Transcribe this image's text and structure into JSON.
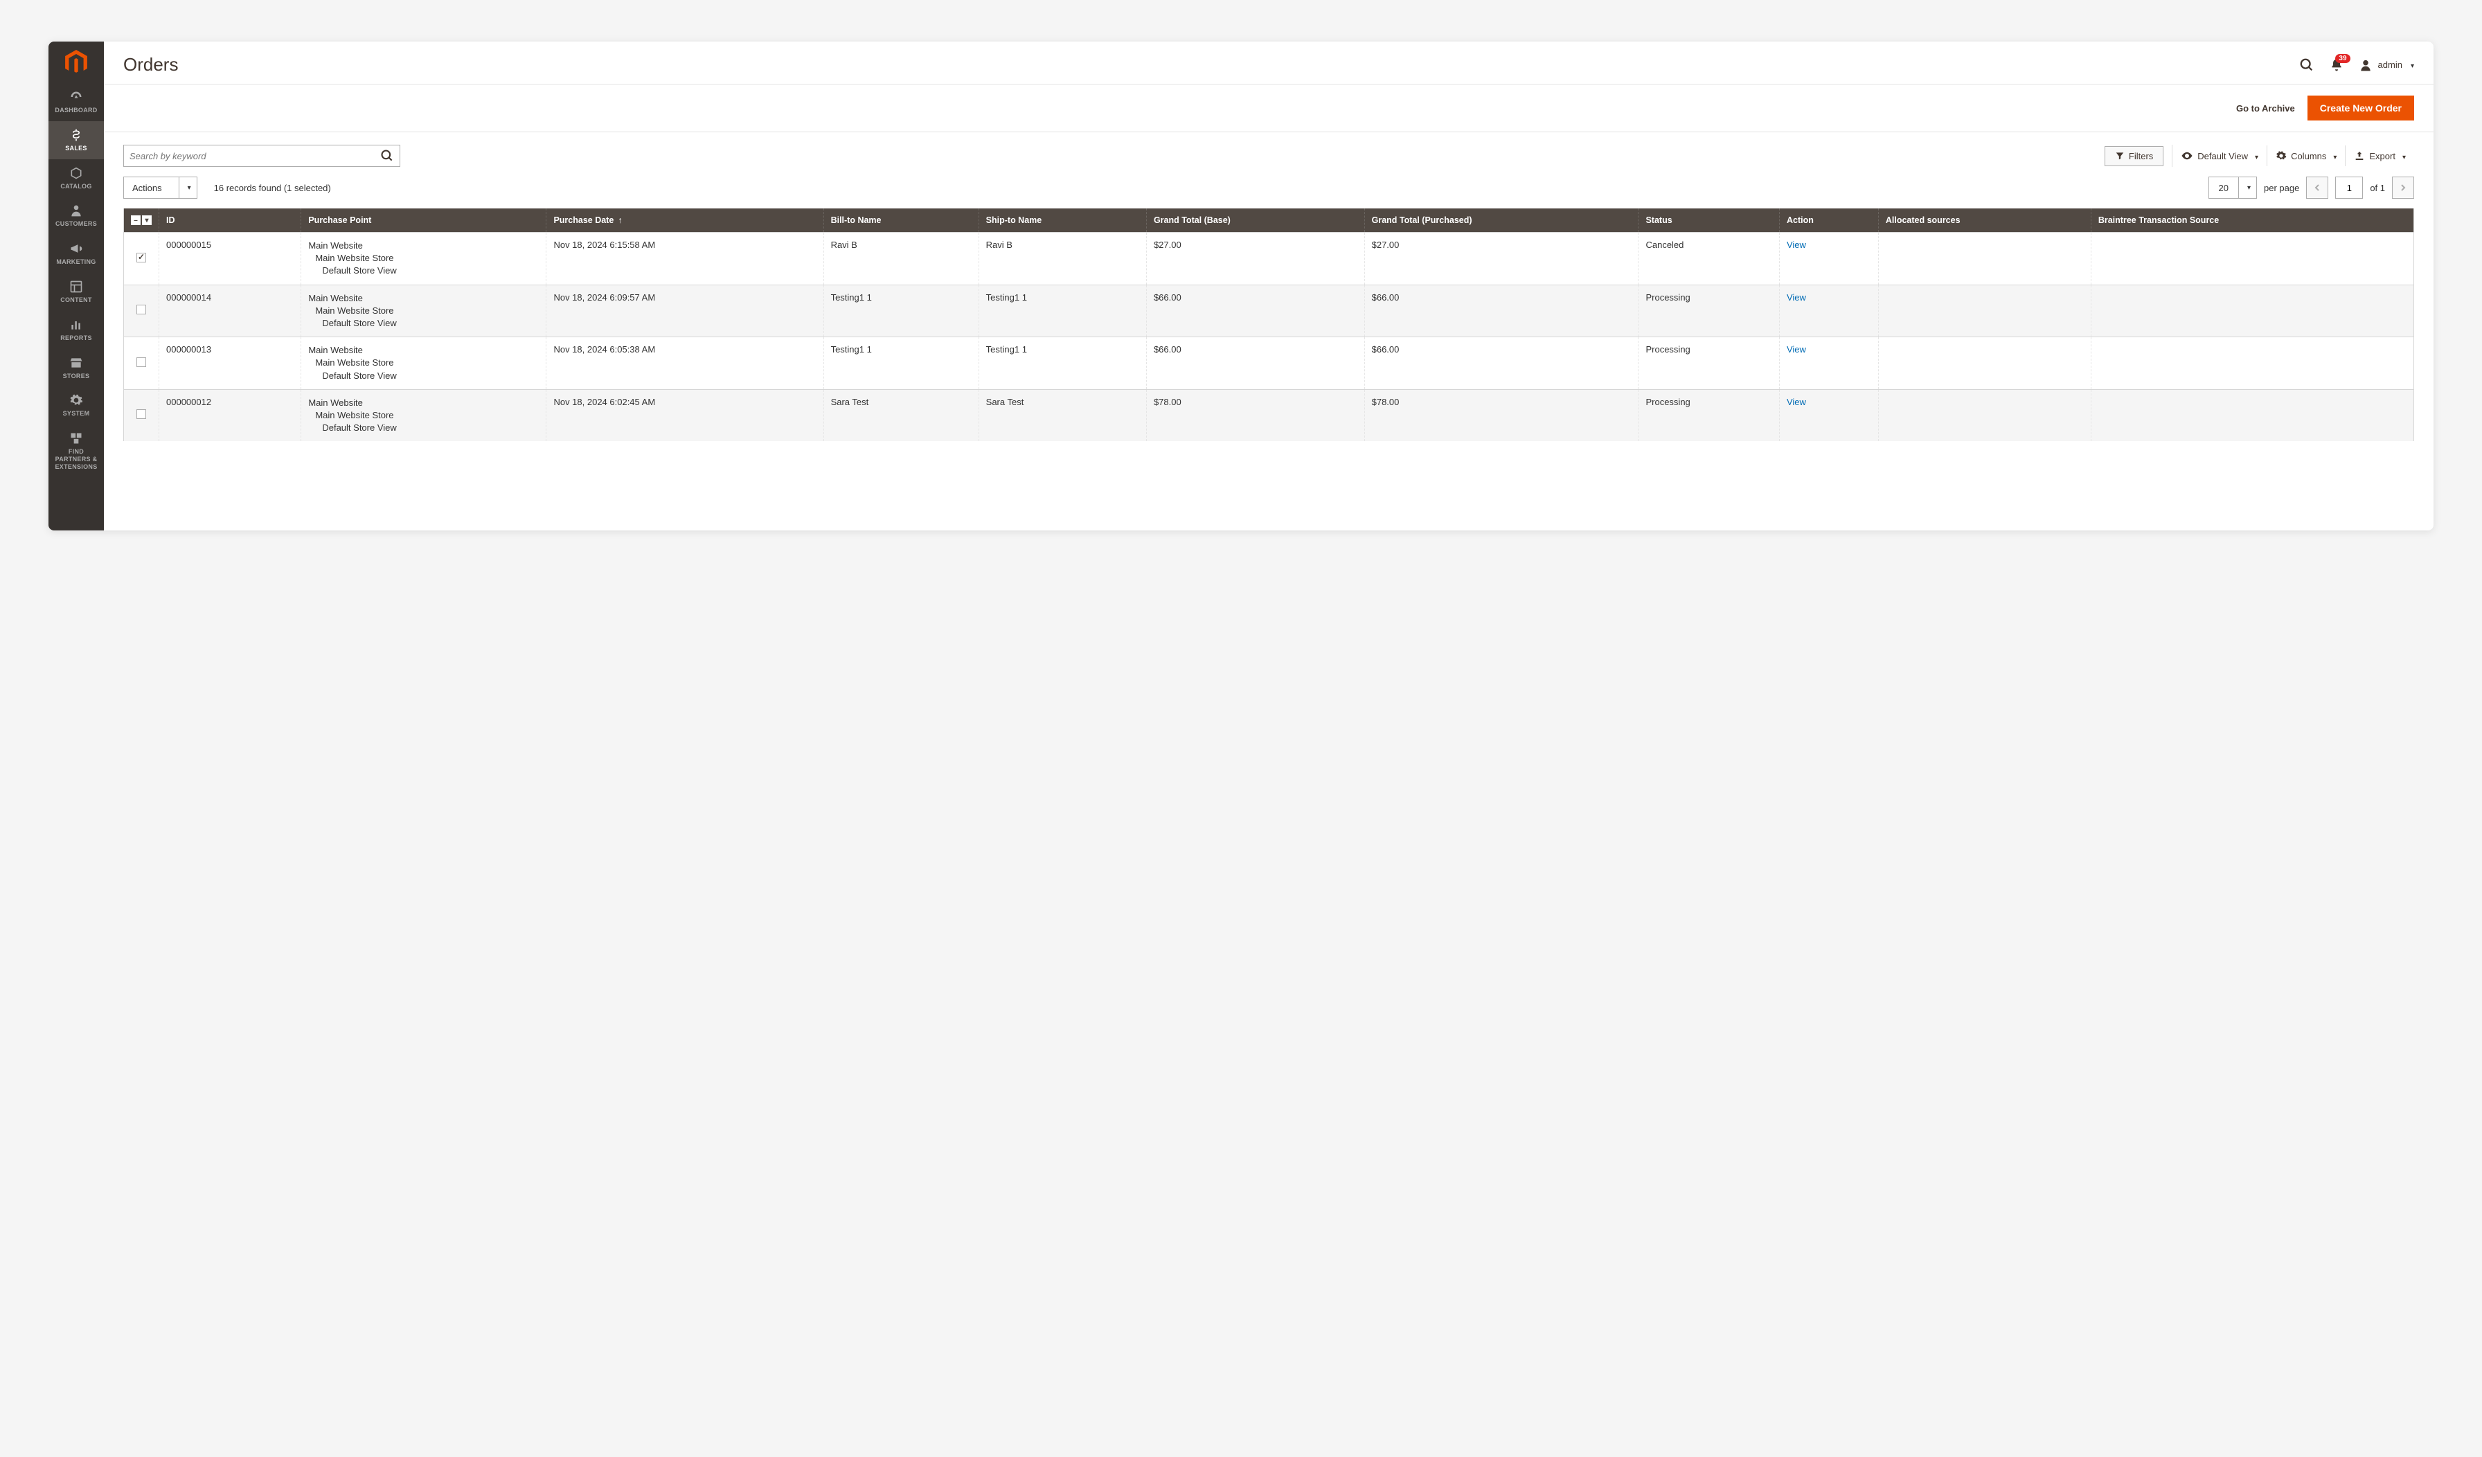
{
  "sidebar": {
    "items": [
      {
        "label": "DASHBOARD",
        "icon": "gauge"
      },
      {
        "label": "SALES",
        "icon": "dollar",
        "active": true
      },
      {
        "label": "CATALOG",
        "icon": "box"
      },
      {
        "label": "CUSTOMERS",
        "icon": "person"
      },
      {
        "label": "MARKETING",
        "icon": "megaphone"
      },
      {
        "label": "CONTENT",
        "icon": "layout"
      },
      {
        "label": "REPORTS",
        "icon": "bars"
      },
      {
        "label": "STORES",
        "icon": "storefront"
      },
      {
        "label": "SYSTEM",
        "icon": "gear"
      },
      {
        "label": "FIND PARTNERS & EXTENSIONS",
        "icon": "boxes"
      }
    ]
  },
  "header": {
    "title": "Orders",
    "notification_count": "39",
    "user_name": "admin"
  },
  "subheader": {
    "archive_label": "Go to Archive",
    "create_label": "Create New Order"
  },
  "toolbar": {
    "search_placeholder": "Search by keyword",
    "filters_label": "Filters",
    "view_label": "Default View",
    "columns_label": "Columns",
    "export_label": "Export"
  },
  "actions": {
    "dropdown_label": "Actions",
    "records_text": "16 records found (1 selected)",
    "page_size": "20",
    "per_page_label": "per page",
    "current_page": "1",
    "total_pages_label": "of 1"
  },
  "table": {
    "columns": [
      "ID",
      "Purchase Point",
      "Purchase Date",
      "Bill-to Name",
      "Ship-to Name",
      "Grand Total (Base)",
      "Grand Total (Purchased)",
      "Status",
      "Action",
      "Allocated sources",
      "Braintree Transaction Source"
    ],
    "view_label": "View",
    "purchase_point": {
      "l1": "Main Website",
      "l2": "Main Website Store",
      "l3": "Default Store View"
    },
    "rows": [
      {
        "checked": true,
        "id": "000000015",
        "date": "Nov 18, 2024 6:15:58 AM",
        "bill": "Ravi B",
        "ship": "Ravi B",
        "base": "$27.00",
        "purchased": "$27.00",
        "status": "Canceled"
      },
      {
        "checked": false,
        "id": "000000014",
        "date": "Nov 18, 2024 6:09:57 AM",
        "bill": "Testing1 1",
        "ship": "Testing1 1",
        "base": "$66.00",
        "purchased": "$66.00",
        "status": "Processing"
      },
      {
        "checked": false,
        "id": "000000013",
        "date": "Nov 18, 2024 6:05:38 AM",
        "bill": "Testing1 1",
        "ship": "Testing1 1",
        "base": "$66.00",
        "purchased": "$66.00",
        "status": "Processing"
      },
      {
        "checked": false,
        "id": "000000012",
        "date": "Nov 18, 2024 6:02:45 AM",
        "bill": "Sara Test",
        "ship": "Sara Test",
        "base": "$78.00",
        "purchased": "$78.00",
        "status": "Processing"
      }
    ]
  }
}
